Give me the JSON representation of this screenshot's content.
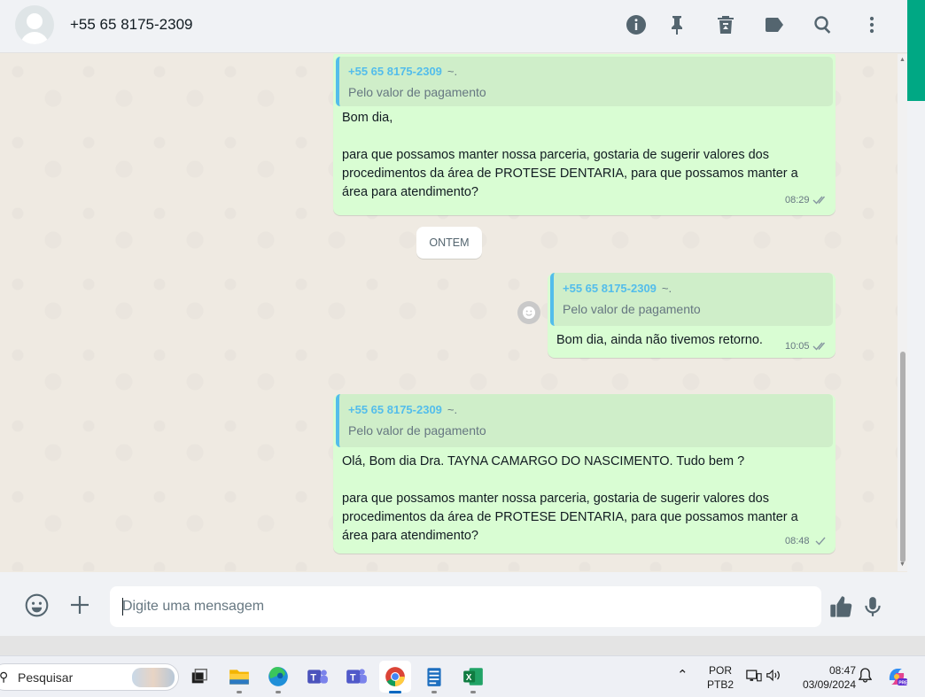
{
  "header": {
    "contact_name": "+55 65 8175-2309",
    "icons": [
      "info-icon",
      "pin-icon",
      "delete-icon",
      "label-icon",
      "search-icon",
      "menu-icon"
    ]
  },
  "messages": [
    {
      "quote_name": "+55 65 8175-2309",
      "quote_suffix": "~.",
      "quote_text": "Pelo valor de pagamento",
      "text": "Bom dia,\n\npara que possamos manter nossa parceria, gostaria de sugerir valores dos\nprocedimentos da área de PROTESE DENTARIA, para que possamos manter a\nárea para atendimento?",
      "time": "08:29",
      "status": "read"
    },
    {
      "quote_name": "+55 65 8175-2309",
      "quote_suffix": "~.",
      "quote_text": "Pelo valor de pagamento",
      "text": "Bom dia, ainda não tivemos retorno.",
      "time": "10:05",
      "status": "read"
    },
    {
      "quote_name": "+55 65 8175-2309",
      "quote_suffix": "~.",
      "quote_text": "Pelo valor de pagamento",
      "text": "Olá, Bom dia Dra. TAYNA CAMARGO DO NASCIMENTO. Tudo bem ?\n\npara que possamos manter nossa parceria, gostaria de sugerir valores dos\nprocedimentos da área de PROTESE DENTARIA, para que possamos manter a\nárea para atendimento?",
      "time": "08:48",
      "status": "sent"
    }
  ],
  "date_divider": "ONTEM",
  "composer": {
    "placeholder": "Digite uma mensagem"
  },
  "taskbar": {
    "search_label": "Pesquisar",
    "language_line1": "POR",
    "language_line2": "PTB2",
    "time": "08:47",
    "date": "03/09/2024",
    "apps": [
      "task-view",
      "file-explorer",
      "edge",
      "teams-personal",
      "teams-work",
      "chrome",
      "notepad",
      "excel"
    ]
  },
  "colors": {
    "bubble_out": "#d9fdd3",
    "quote_accent": "#53bdeb",
    "accent": "#00a884",
    "chat_bg": "#efeae2"
  }
}
